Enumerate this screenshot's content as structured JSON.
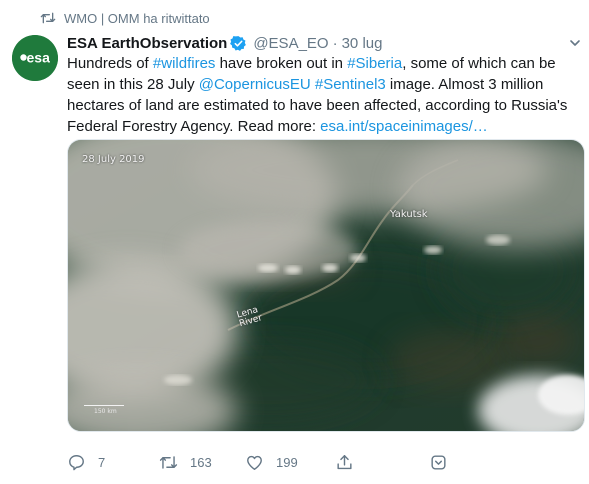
{
  "retweet_banner": {
    "icon": "retweet-icon",
    "text": "WMO | OMM ha ritwittato"
  },
  "author": {
    "avatar_icon": "esa-logo",
    "avatar_text": "esa",
    "name": "ESA EarthObservation",
    "verified_icon": "verified-badge-icon",
    "handle": "@ESA_EO",
    "separator": "·",
    "timestamp": "30 lug"
  },
  "tweet": {
    "line1": {
      "t1": "Hundreds of ",
      "l1": "#wildfires",
      "t2": " have broken out in ",
      "l2": "#Siberia",
      "t3": ", some of which can be"
    },
    "line2": {
      "t1": "seen in this 28 July ",
      "l1": "@CopernicusEU",
      "t2": " ",
      "l2": "#Sentinel3",
      "t3": " image. Almost 3 million"
    },
    "line3": {
      "t1": "hectares of land are estimated to have been affected, according to Russia's"
    },
    "line4": {
      "t1": "Federal Forestry Agency. Read more: ",
      "l1": "esa.int/spaceinimages/…"
    }
  },
  "media": {
    "alt": "Satellite image of wildfire smoke over Siberia",
    "date_label": "28 July 2019",
    "city_label": "Yakutsk",
    "river_label_1": "Lena",
    "river_label_2": "River",
    "scale_label": "150 km"
  },
  "actions": {
    "reply": {
      "icon": "reply-icon",
      "count": "7"
    },
    "retweet": {
      "icon": "retweet-icon",
      "count": "163"
    },
    "like": {
      "icon": "heart-icon",
      "count": "199"
    },
    "share": {
      "icon": "share-icon"
    },
    "analytics": {
      "icon": "chevron-menu-icon"
    }
  },
  "colors": {
    "link": "#1b95e0",
    "muted": "#657786",
    "verified": "#1da1f2",
    "avatar_bg": "#1f7a3c"
  }
}
